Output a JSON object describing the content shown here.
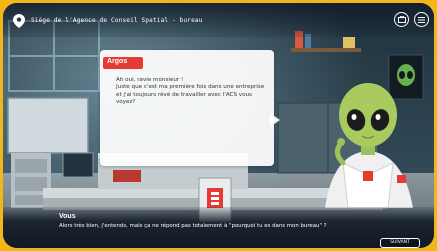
{
  "header": {
    "location": "Siège de l'Agence de Conseil Spatial - bureau",
    "icons": [
      "location-pin-icon",
      "inventory-icon",
      "menu-icon"
    ]
  },
  "npc_dialog": {
    "speaker": "Argos",
    "lines": [
      "Ah oui, ravie monsieur !",
      "Juste que c'est ma première fois dans une entreprise et j'ai toujours rêvé de travailler avec l'ACS vous voyez?"
    ]
  },
  "player_dialog": {
    "speaker": "Vous",
    "line": "Alors très bien, j'entends, mais ça ne répond pas totalement à \"pourquoi tu es dans mon bureau\" ?",
    "next_label": "SUIVANT"
  },
  "colors": {
    "frame": "#f2b619",
    "speaker_tag": "#e63a35",
    "alien_skin": "#9ec15a",
    "wall": "#2a3e4a"
  }
}
